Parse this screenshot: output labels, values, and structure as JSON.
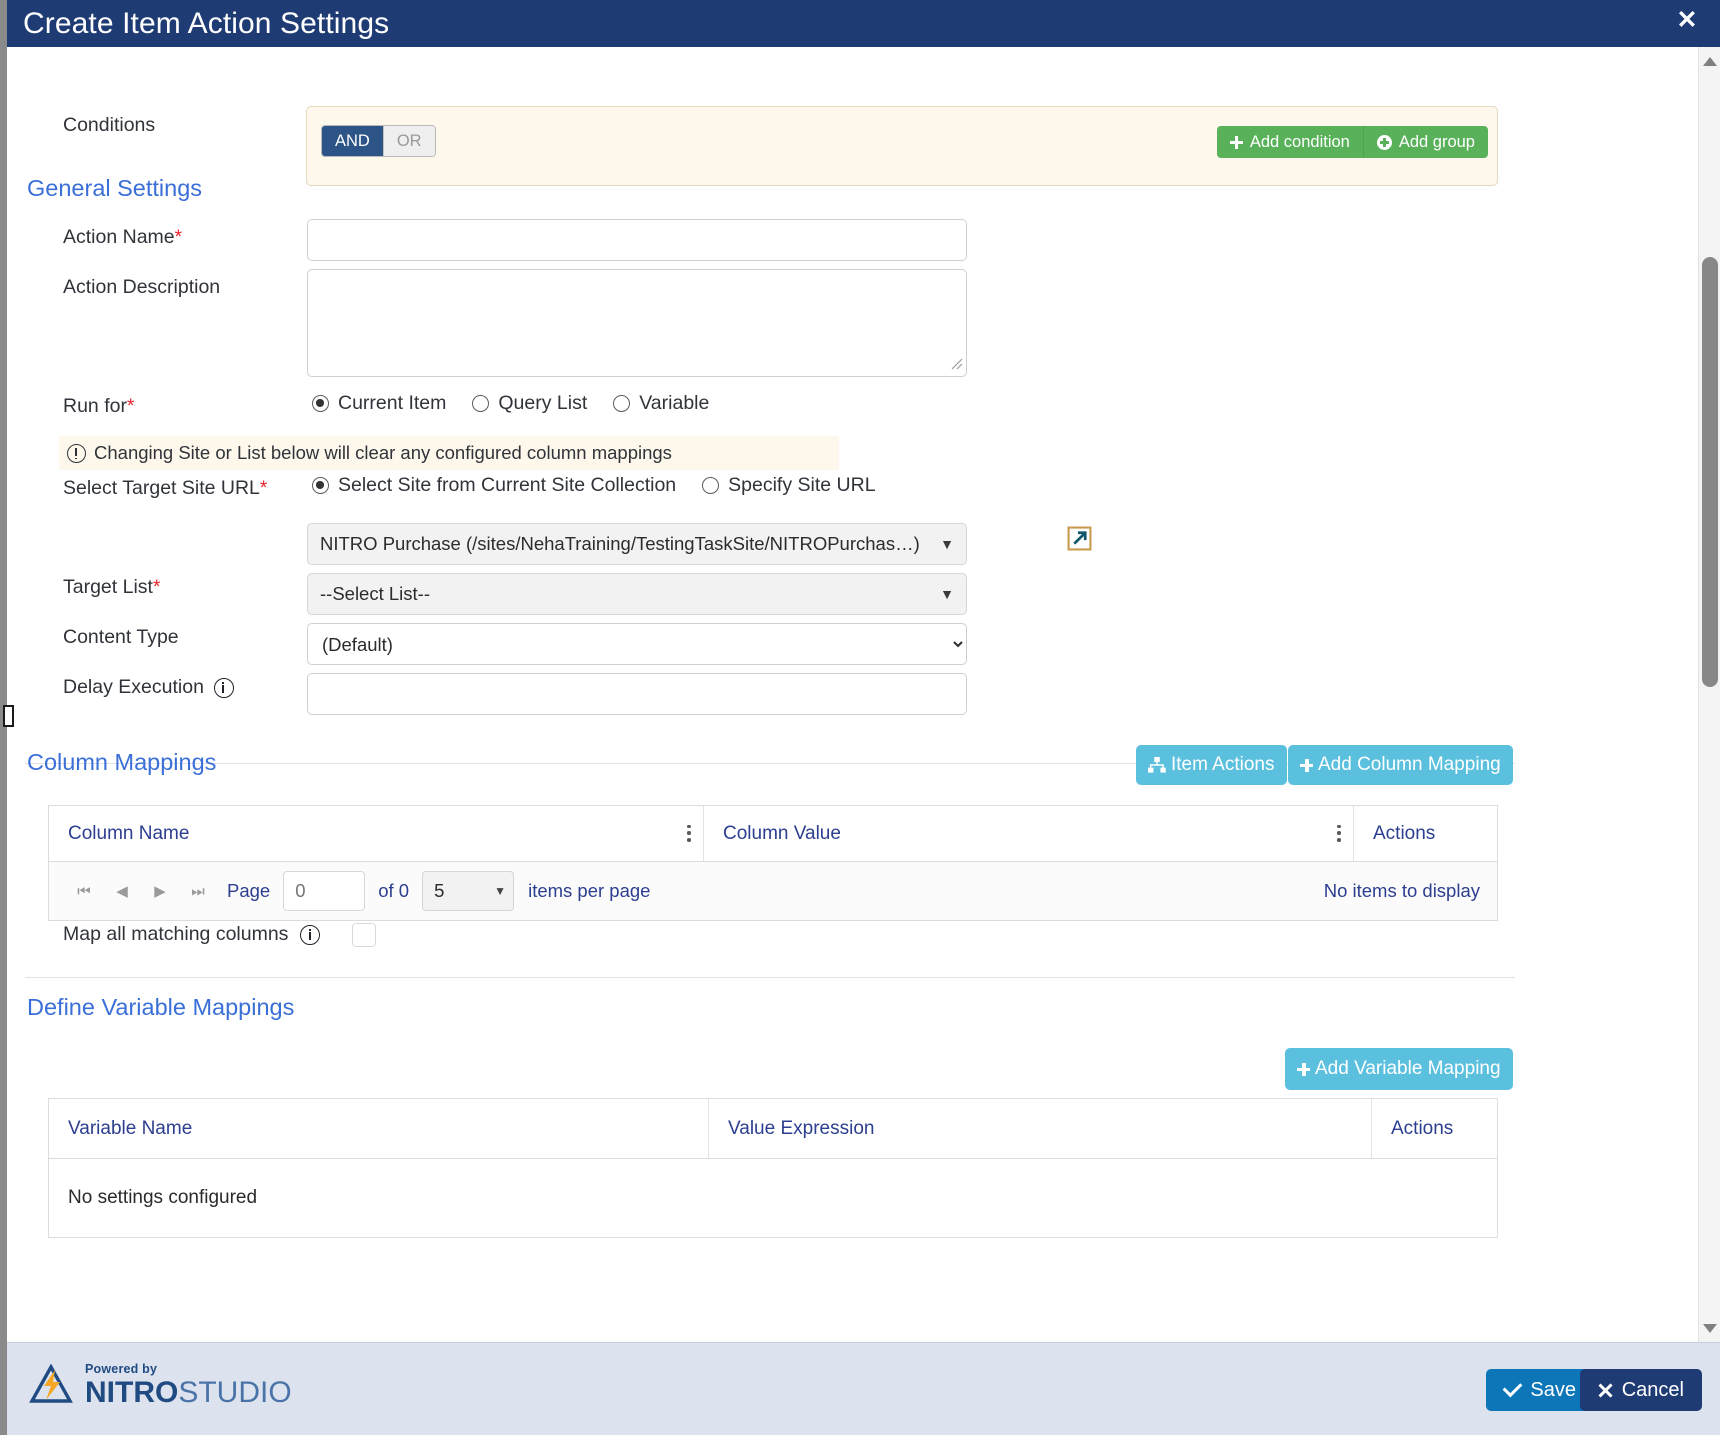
{
  "window": {
    "title": "Create Item Action Settings",
    "close_label": "✕"
  },
  "conditions": {
    "label": "Conditions",
    "operator_and": "AND",
    "operator_or": "OR",
    "selected_operator": "AND",
    "add_condition_label": "Add condition",
    "add_group_label": "Add group"
  },
  "general_settings": {
    "heading": "General Settings",
    "action_name": {
      "label": "Action Name",
      "required": "*",
      "value": "",
      "placeholder": ""
    },
    "action_description": {
      "label": "Action Description",
      "value": "",
      "placeholder": ""
    },
    "run_for": {
      "label": "Run for",
      "required": "*",
      "options": [
        "Current Item",
        "Query List",
        "Variable"
      ],
      "selected": "Current Item"
    },
    "notice": "Changing Site or List below will clear any configured column mappings",
    "target_site_url": {
      "label": "Select Target Site URL",
      "required": "*",
      "options": [
        "Select Site from Current Site Collection",
        "Specify Site URL"
      ],
      "selected": "Select Site from Current Site Collection",
      "site_value": "NITRO Purchase (/sites/NehaTraining/TestingTaskSite/NITROPurchas…)"
    },
    "target_list": {
      "label": "Target List",
      "required": "*",
      "value": "--Select List--"
    },
    "content_type": {
      "label": "Content Type",
      "value": "(Default)",
      "options": [
        "(Default)"
      ]
    },
    "delay_execution": {
      "label": "Delay Execution",
      "value": "",
      "placeholder": ""
    }
  },
  "column_mappings": {
    "heading": "Column Mappings",
    "item_actions_label": "Item Actions",
    "add_mapping_label": "Add Column Mapping",
    "columns": [
      "Column Name",
      "Column Value",
      "Actions"
    ],
    "rows": [],
    "pager": {
      "page_label": "Page",
      "page_value": "0",
      "of_label": "of 0",
      "page_size": "5",
      "items_per_page_label": "items per page",
      "empty_text": "No items to display"
    },
    "map_all": {
      "label": "Map all matching columns",
      "checked": false
    }
  },
  "variable_mappings": {
    "heading": "Define Variable Mappings",
    "add_mapping_label": "Add Variable Mapping",
    "columns": [
      "Variable Name",
      "Value Expression",
      "Actions"
    ],
    "empty_text": "No settings configured"
  },
  "footer": {
    "logo_powered": "Powered by",
    "logo_nitro": "NITRO",
    "logo_studio": "STUDIO",
    "save_label": "Save",
    "cancel_label": "Cancel"
  },
  "colors": {
    "title_bar": "#1f3b73",
    "accent_blue": "#3a6fd8",
    "green_button": "#59b25a",
    "light_blue_button": "#5bc0de",
    "save_blue": "#0d76b9",
    "cancel_navy": "#1f3b73",
    "required_red": "#e8212b",
    "notice_bg": "#fdf7ec"
  }
}
